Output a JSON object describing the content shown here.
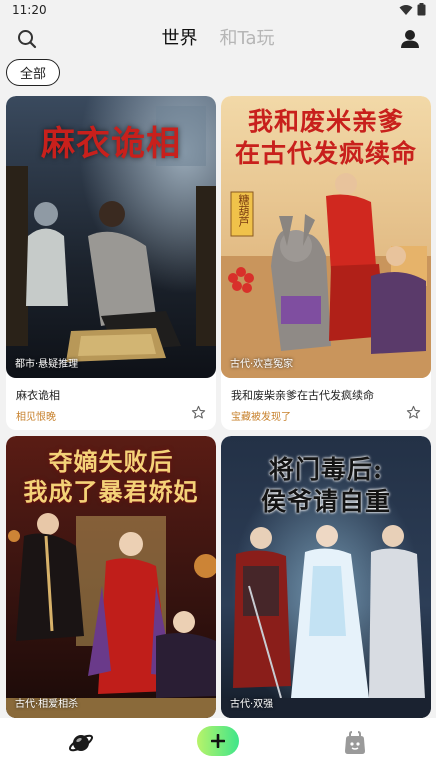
{
  "status_bar": {
    "time": "11:20",
    "icons": [
      "wifi-icon",
      "battery-icon"
    ]
  },
  "header": {
    "tabs": [
      {
        "label": "世界",
        "active": true
      },
      {
        "label": "和Ta玩",
        "active": false
      }
    ],
    "icons": [
      "search-icon",
      "profile-icon"
    ]
  },
  "filter": {
    "label": "全部"
  },
  "cards": [
    {
      "cover_title": "麻衣诡相",
      "genre": "都市·悬疑推理",
      "title": "麻衣诡相",
      "author": "相见恨晚"
    },
    {
      "cover_title_line1": "我和废米亲爹",
      "cover_title_line2": "在古代发疯续命",
      "cover_sign": "糖葫芦",
      "genre": "古代·欢喜冤家",
      "title": "我和废柴亲爹在古代发疯续命",
      "author": "宝藏被发现了"
    },
    {
      "cover_title_line1": "夺嫡失败后",
      "cover_title_line2": "我成了暴君娇妃",
      "genre": "古代·相爱相杀"
    },
    {
      "cover_title_line1": "将门毒后:",
      "cover_title_line2": "侯爷请自重",
      "genre": "古代·双强"
    }
  ],
  "bottom_nav": {
    "icons": [
      "planet-icon",
      "add-icon",
      "bag-icon"
    ]
  },
  "colors": {
    "author": "#c7802b",
    "add_gradient_start": "#b8f36a",
    "add_gradient_end": "#3fe58a",
    "cover_red": "#c8201c"
  }
}
